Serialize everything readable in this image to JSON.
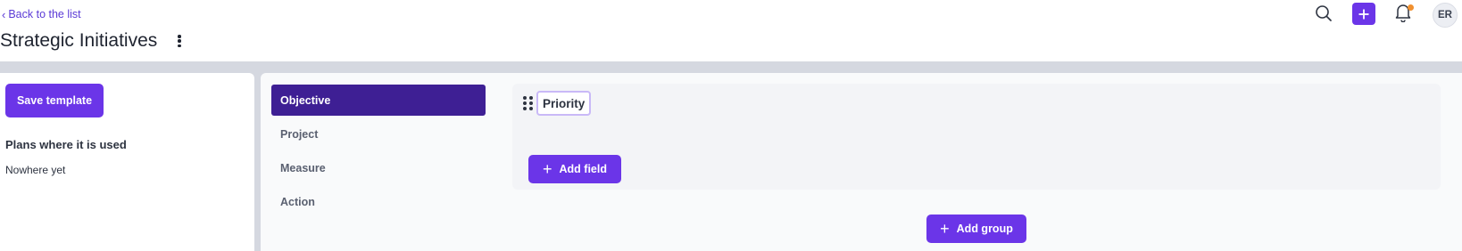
{
  "header": {
    "back_label": "Back to the list",
    "title": "Strategic Initiatives",
    "avatar_initials": "ER"
  },
  "icons": {
    "search": "search-icon",
    "create": "plus-icon",
    "notifications": "bell-icon",
    "more": "kebab-icon",
    "drag": "drag-handle-icon"
  },
  "colors": {
    "accent": "#6b35e8",
    "active_item": "#3e1f94",
    "link": "#5b3ad6",
    "notification_dot": "#f0902f",
    "page_bg": "#d5d8e0"
  },
  "sidebar": {
    "save_label": "Save template",
    "plans_heading": "Plans where it is used",
    "plans_empty": "Nowhere yet"
  },
  "types": [
    {
      "label": "Objective",
      "active": true
    },
    {
      "label": "Project",
      "active": false
    },
    {
      "label": "Measure",
      "active": false
    },
    {
      "label": "Action",
      "active": false
    }
  ],
  "group": {
    "fields": [
      {
        "label": "Priority"
      }
    ],
    "add_field_label": "Add field"
  },
  "add_group_label": "Add group"
}
